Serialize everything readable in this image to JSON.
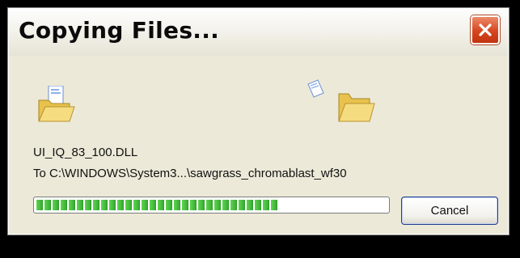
{
  "window": {
    "title": "Copying Files..."
  },
  "copy": {
    "file_name": "UI_IQ_83_100.DLL",
    "destination": "To C:\\WINDOWS\\System3...\\sawgrass_chromablast_wf30",
    "progress_fraction": 0.69
  },
  "buttons": {
    "cancel_label": "Cancel"
  },
  "icons": {
    "close": "close-icon",
    "source_folder": "folder-open-icon",
    "flying_doc": "document-icon",
    "dest_folder": "folder-open-icon"
  },
  "colors": {
    "window_bg": "#ece9d8",
    "close_red": "#d6461f",
    "progress_green": "#3fb33a"
  }
}
